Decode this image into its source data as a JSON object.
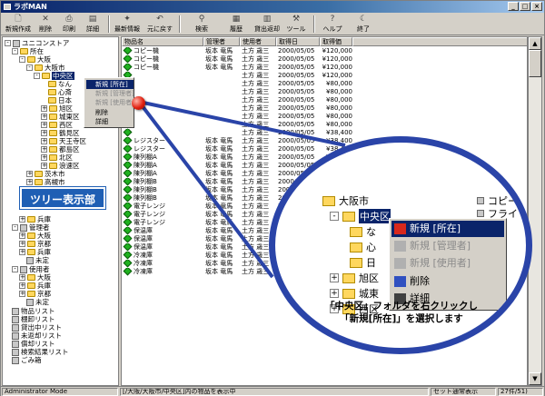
{
  "window": {
    "title": "ラボMAN"
  },
  "toolbar": [
    {
      "label": "新規作成",
      "icon": "new-icon"
    },
    {
      "label": "削除",
      "icon": "delete-icon"
    },
    {
      "label": "印刷",
      "icon": "print-icon"
    },
    {
      "label": "詳細",
      "icon": "detail-icon"
    },
    {
      "label": "最新情報",
      "icon": "refresh-icon"
    },
    {
      "label": "元に戻す",
      "icon": "undo-icon"
    },
    {
      "label": "検索",
      "icon": "search-icon"
    },
    {
      "label": "履歴",
      "icon": "history-icon"
    },
    {
      "label": "貸出返却",
      "icon": "lend-icon"
    },
    {
      "label": "ツール",
      "icon": "tool-icon"
    },
    {
      "label": "ヘルプ",
      "icon": "help-icon"
    },
    {
      "label": "終了",
      "icon": "exit-icon"
    }
  ],
  "tree": {
    "root": "ユニコンストア",
    "nodes": [
      {
        "label": "所在"
      },
      {
        "label": "大阪"
      },
      {
        "label": "大阪市"
      },
      {
        "label": "中央区"
      },
      {
        "label": "なん"
      },
      {
        "label": "心斎"
      },
      {
        "label": "日本"
      },
      {
        "label": "旭区"
      },
      {
        "label": "城東区"
      },
      {
        "label": "西区"
      },
      {
        "label": "鶴見区"
      },
      {
        "label": "天王寺区"
      },
      {
        "label": "都島区"
      },
      {
        "label": "北区"
      },
      {
        "label": "浪速区"
      },
      {
        "label": "茨木市"
      },
      {
        "label": "高槻市"
      },
      {
        "label": "兵庫"
      },
      {
        "label": "管理者"
      },
      {
        "label": "大阪"
      },
      {
        "label": "京都"
      },
      {
        "label": "兵庫"
      },
      {
        "label": "未定"
      },
      {
        "label": "使用者"
      },
      {
        "label": "大阪"
      },
      {
        "label": "兵庫"
      },
      {
        "label": "京都"
      },
      {
        "label": "未定"
      },
      {
        "label": "物品リスト"
      },
      {
        "label": "棚卸リスト"
      },
      {
        "label": "貸出中リスト"
      },
      {
        "label": "未返却リスト"
      },
      {
        "label": "償却リスト"
      },
      {
        "label": "検索結果リスト"
      },
      {
        "label": "ごみ箱"
      }
    ]
  },
  "context_menu": {
    "items": [
      {
        "label": "新規 [所在]"
      },
      {
        "label": "新規 [管理者]"
      },
      {
        "label": "新規 [使用者]"
      },
      {
        "label": "削除"
      },
      {
        "label": "詳細"
      }
    ]
  },
  "table": {
    "columns": [
      "物品名",
      "管理者",
      "使用者",
      "取得日",
      "取得価"
    ],
    "rows": [
      [
        "コピー機",
        "坂本 竜馬",
        "土方 歳三",
        "2000/05/05",
        "¥120,000"
      ],
      [
        "コピー機",
        "坂本 竜馬",
        "土方 歳三",
        "2000/05/05",
        "¥120,000"
      ],
      [
        "コピー機",
        "坂本 竜馬",
        "土方 歳三",
        "2000/05/05",
        "¥120,000"
      ],
      [
        "",
        "",
        "土方 歳三",
        "2000/05/05",
        "¥120,000"
      ],
      [
        "",
        "",
        "土方 歳三",
        "2000/05/05",
        "¥80,000"
      ],
      [
        "",
        "",
        "土方 歳三",
        "2000/05/05",
        "¥80,000"
      ],
      [
        "",
        "",
        "土方 歳三",
        "2000/05/05",
        "¥80,000"
      ],
      [
        "",
        "",
        "土方 歳三",
        "2000/05/05",
        "¥80,000"
      ],
      [
        "",
        "",
        "土方 歳三",
        "2000/05/05",
        "¥80,000"
      ],
      [
        "",
        "",
        "土方 歳三",
        "2000/05/05",
        "¥80,000"
      ],
      [
        "",
        "",
        "土方 歳三",
        "2000/05/05",
        "¥38,400"
      ],
      [
        "レジスター",
        "坂本 竜馬",
        "土方 歳三",
        "2000/05/05",
        "¥38,400"
      ],
      [
        "レジスター",
        "坂本 竜馬",
        "土方 歳三",
        "2000/05/05",
        "¥38,400"
      ],
      [
        "陳列棚A",
        "坂本 竜馬",
        "土方 歳三",
        "2000/05/05",
        "¥37,500"
      ],
      [
        "陳列棚A",
        "坂本 竜馬",
        "土方 歳三",
        "2000/05/05",
        "¥37,500"
      ],
      [
        "陳列棚A",
        "坂本 竜馬",
        "土方 歳三",
        "2000/05/05",
        "¥37,500"
      ],
      [
        "陳列棚B",
        "坂本 竜馬",
        "土方 歳三",
        "2000/05/05",
        ""
      ],
      [
        "陳列棚B",
        "坂本 竜馬",
        "土方 歳三",
        "2000/05/05",
        ""
      ],
      [
        "陳列棚B",
        "坂本 竜馬",
        "土方 歳三",
        "2000/05/05",
        ""
      ],
      [
        "電子レンジ",
        "坂本 竜馬",
        "土方 歳三",
        "2000/05/05",
        ""
      ],
      [
        "電子レンジ",
        "坂本 竜馬",
        "土方 歳三",
        "2000/05/05",
        ""
      ],
      [
        "電子レンジ",
        "坂本 竜馬",
        "土方 歳三",
        "2000/05/05",
        ""
      ],
      [
        "保温庫",
        "坂本 竜馬",
        "土方 歳三",
        "2000/05/05",
        ""
      ],
      [
        "保温庫",
        "坂本 竜馬",
        "土方 歳三",
        "2000/05/05",
        ""
      ],
      [
        "保温庫",
        "坂本 竜馬",
        "土方 歳三",
        "2000/05/05",
        ""
      ],
      [
        "冷凍庫",
        "坂本 竜馬",
        "土方 歳三",
        "2000/05/05",
        ""
      ],
      [
        "冷凍庫",
        "坂本 竜馬",
        "土方 歳三",
        "2000/05/05",
        ""
      ],
      [
        "冷凍庫",
        "坂本 竜馬",
        "土方 歳三",
        "2000/05/05",
        ""
      ]
    ]
  },
  "zoom": {
    "nodes": [
      "大阪市",
      "中央区",
      "な",
      "心",
      "日",
      "旭区",
      "城東",
      "西区"
    ],
    "table_items": [
      "コピー",
      "フライ"
    ],
    "menu": [
      {
        "label": "新規 [所在]"
      },
      {
        "label": "新規 [管理者]"
      },
      {
        "label": "新規 [使用者]"
      },
      {
        "label": "削除"
      },
      {
        "label": "詳細"
      }
    ],
    "caption_line1": "「中央区」フォルダを右クリックし",
    "caption_line2": "「新規[所在]」を選択します"
  },
  "callout": {
    "label": "ツリー表示部"
  },
  "status": {
    "mode": "Administrator Mode",
    "path": "[/大阪/大阪市/中央区]内の物品を表示中",
    "display": "セット通常表示",
    "count": "27件/51)"
  },
  "colors": {
    "accent": "#0a246a",
    "callout": "#1f5fb4",
    "zoom_border": "#2a44a8",
    "item_gem": "#1fb11f"
  }
}
